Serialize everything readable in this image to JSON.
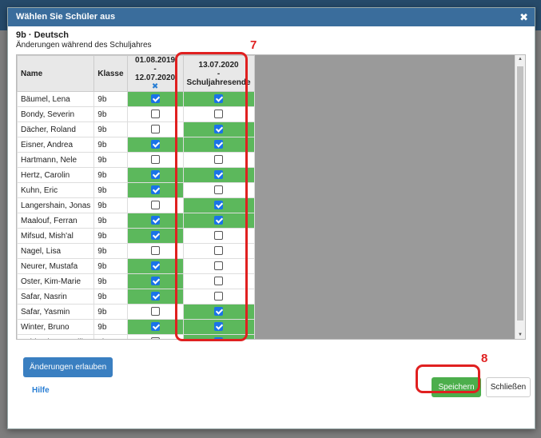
{
  "dialog": {
    "title": "Wählen Sie Schüler aus",
    "close_glyph": "✖",
    "subtitle": "9b · Deutsch",
    "description": "Änderungen während des Schuljahres"
  },
  "table": {
    "headers": {
      "name": "Name",
      "klasse": "Klasse",
      "period1_start": "01.08.2019",
      "period1_dash": "-",
      "period1_end": "12.07.2020",
      "period1_remove_glyph": "✖",
      "period2_start": "13.07.2020",
      "period2_dash": "-",
      "period2_end": "Schuljahresende"
    },
    "rows": [
      {
        "name": "Bäumel, Lena",
        "klasse": "9b",
        "p1": true,
        "p2": true
      },
      {
        "name": "Bondy, Severin",
        "klasse": "9b",
        "p1": false,
        "p2": false
      },
      {
        "name": "Dächer, Roland",
        "klasse": "9b",
        "p1": false,
        "p2": true
      },
      {
        "name": "Eisner, Andrea",
        "klasse": "9b",
        "p1": true,
        "p2": true
      },
      {
        "name": "Hartmann, Nele",
        "klasse": "9b",
        "p1": false,
        "p2": false
      },
      {
        "name": "Hertz, Carolin",
        "klasse": "9b",
        "p1": true,
        "p2": true
      },
      {
        "name": "Kuhn, Eric",
        "klasse": "9b",
        "p1": true,
        "p2": false
      },
      {
        "name": "Langershain, Jonas",
        "klasse": "9b",
        "p1": false,
        "p2": true
      },
      {
        "name": "Maalouf, Ferran",
        "klasse": "9b",
        "p1": true,
        "p2": true
      },
      {
        "name": "Mifsud, Mish'al",
        "klasse": "9b",
        "p1": true,
        "p2": false
      },
      {
        "name": "Nagel, Lisa",
        "klasse": "9b",
        "p1": false,
        "p2": false
      },
      {
        "name": "Neurer, Mustafa",
        "klasse": "9b",
        "p1": true,
        "p2": false
      },
      {
        "name": "Oster, Kim-Marie",
        "klasse": "9b",
        "p1": true,
        "p2": false
      },
      {
        "name": "Safar, Nasrin",
        "klasse": "9b",
        "p1": true,
        "p2": false
      },
      {
        "name": "Safar, Yasmin",
        "klasse": "9b",
        "p1": false,
        "p2": true
      },
      {
        "name": "Winter, Bruno",
        "klasse": "9b",
        "p1": true,
        "p2": true
      },
      {
        "name": "Zahlmeister, Malik",
        "klasse": "9b",
        "p1": false,
        "p2": true
      }
    ]
  },
  "annotations": {
    "marker7": "7",
    "marker8": "8"
  },
  "buttons": {
    "allow_changes": "Änderungen erlauben",
    "help": "Hilfe",
    "save": "Speichern",
    "close": "Schließen"
  },
  "colors": {
    "checked_cell": "#5cb85c",
    "accent": "#3a6d9c",
    "highlight": "#e02020"
  }
}
